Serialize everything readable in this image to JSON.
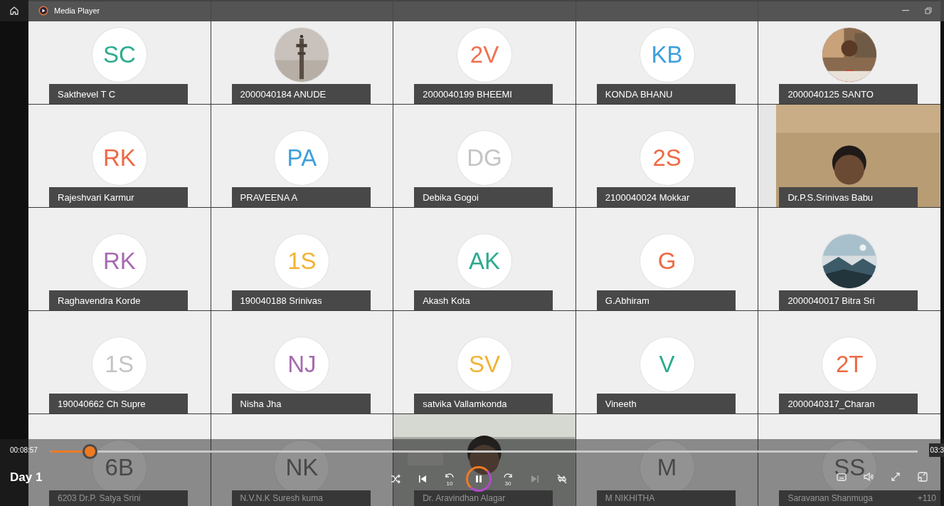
{
  "title_bar": {
    "title": "Media Player"
  },
  "participants": [
    {
      "kind": "initials",
      "initials": "SC",
      "color": "#2bab8e",
      "name": "Sakthevel T C"
    },
    {
      "name": "2000040184 ANUDE"
    },
    {
      "kind": "initials",
      "initials": "2V",
      "color": "#f0714f",
      "name": "2000040199 BHEEMI"
    },
    {
      "kind": "initials",
      "initials": "KB",
      "color": "#3c9fdc",
      "name": "KONDA BHANU"
    },
    {
      "name": "2000040125 SANTO"
    },
    {
      "kind": "initials",
      "initials": "RK",
      "color": "#ee6a44",
      "name": "Rajeshvari Karmur"
    },
    {
      "kind": "initials",
      "initials": "PA",
      "color": "#3c9fdc",
      "name": "PRAVEENA A"
    },
    {
      "kind": "initials",
      "initials": "DG",
      "color": "#c4c4c4",
      "name": "Debika Gogoi"
    },
    {
      "kind": "initials",
      "initials": "2S",
      "color": "#ee6a44",
      "name": "2100040024 Mokkar"
    },
    {
      "kind": "video",
      "name": "Dr.P.S.Srinivas Babu"
    },
    {
      "kind": "initials",
      "initials": "RK",
      "color": "#a66bb0",
      "name": "Raghavendra Korde"
    },
    {
      "kind": "initials",
      "initials": "1S",
      "color": "#f2b233",
      "name": "190040188 Srinivas"
    },
    {
      "kind": "initials",
      "initials": "AK",
      "color": "#2bab8e",
      "name": "Akash Kota"
    },
    {
      "kind": "initials",
      "initials": "G",
      "color": "#ee6a44",
      "name": "G.Abhiram"
    },
    {
      "name": "2000040017 Bitra Sri"
    },
    {
      "kind": "initials",
      "initials": "1S",
      "color": "#c4c4c4",
      "name": "190040662 Ch Supre"
    },
    {
      "kind": "initials",
      "initials": "NJ",
      "color": "#a66bb0",
      "name": "Nisha Jha"
    },
    {
      "kind": "initials",
      "initials": "SV",
      "color": "#f2b233",
      "name": "satvika Vallamkonda"
    },
    {
      "kind": "initials",
      "initials": "V",
      "color": "#2bab8e",
      "name": "Vineeth"
    },
    {
      "kind": "initials",
      "initials": "2T",
      "color": "#ee6a44",
      "name": "2000040317_Charan"
    },
    {
      "kind": "initials",
      "initials": "6B",
      "name": "6203 Dr.P. Satya Srini"
    },
    {
      "kind": "initials",
      "initials": "NK",
      "name": "N.V.N.K Suresh kuma"
    },
    {
      "kind": "video",
      "name": "Dr. Aravindhan Alagar"
    },
    {
      "kind": "initials",
      "initials": "M",
      "name": "M NIKHITHA"
    },
    {
      "kind": "initials",
      "initials": "SS",
      "name": "Saravanan Shanmuga",
      "extra": "+110"
    }
  ],
  "player": {
    "current_time": "00:08:57",
    "total_time": "03:3",
    "level": 0.045,
    "media_title": "Day 1",
    "playing": true,
    "skip_back": "10",
    "skip_forward": "30"
  }
}
